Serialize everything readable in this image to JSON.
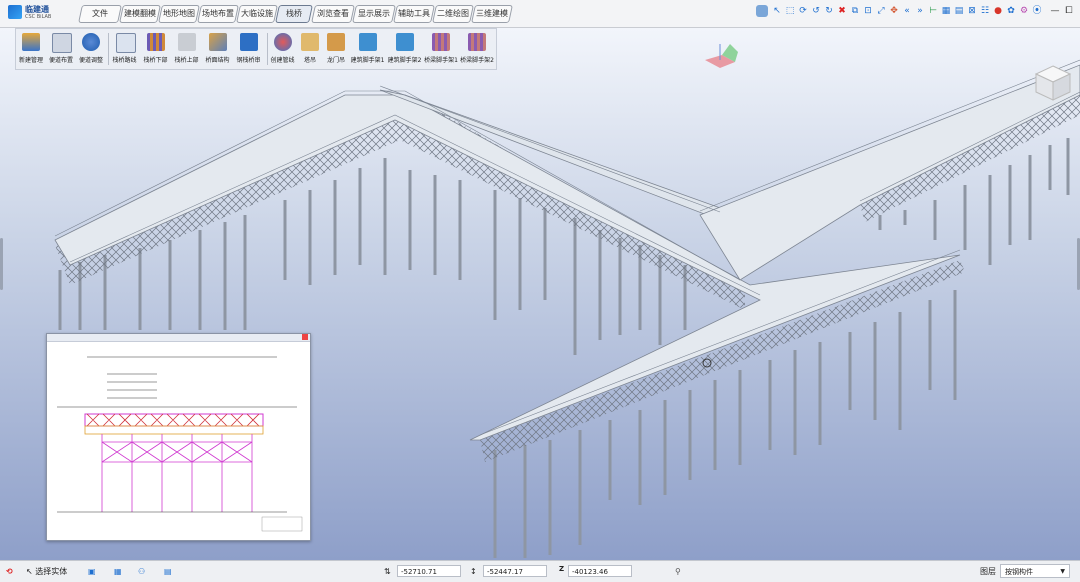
{
  "app": {
    "name": "临建通",
    "subtitle": "CSC BiLAB"
  },
  "tabs": [
    "文件",
    "建模翻模",
    "地形地图",
    "场地布置",
    "大临设施",
    "栈桥",
    "浏览查看",
    "显示展示",
    "辅助工具",
    "二维绘图",
    "三维建模"
  ],
  "active_tab": 5,
  "ribbon": {
    "groups": [
      [
        "新建管理",
        "便道布置",
        "便道调整"
      ],
      [
        "栈桥路线",
        "栈桥下部",
        "栈桥上部",
        "桥面结构",
        "钢栈桥审"
      ],
      [
        "创建管线",
        "塔吊",
        "龙门吊",
        "建筑脚手架1",
        "建筑脚手架2",
        "桥梁脚手架1",
        "桥梁脚手架2"
      ]
    ]
  },
  "status": {
    "select_label": "选择实体",
    "x": "-52710.71",
    "y": "-52447.17",
    "z": "-40123.46",
    "layer_label": "图层",
    "layer_value": "按钢构件"
  },
  "colors": {
    "accent": "#1e6fd0",
    "deck": "#dfe5ec",
    "pier": "#9aa1ad"
  }
}
